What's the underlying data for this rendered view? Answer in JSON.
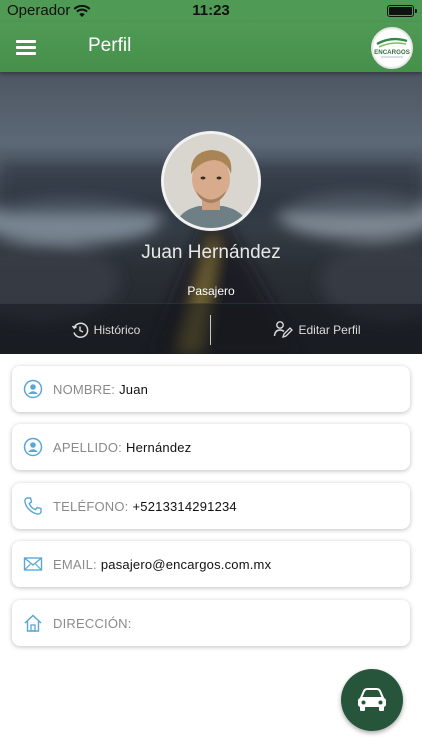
{
  "status_bar": {
    "carrier": "Operador",
    "time": "11:23"
  },
  "nav": {
    "title": "Perfil",
    "logo_text": "ENCARGOS"
  },
  "profile": {
    "name": "Juan Hernández",
    "role": "Pasajero"
  },
  "actions": {
    "history_label": "Histórico",
    "edit_label": "Editar Perfil"
  },
  "fields": {
    "nombre": {
      "label": "NOMBRE:",
      "value": "Juan",
      "icon": "user-badge-icon"
    },
    "apellido": {
      "label": "APELLIDO:",
      "value": "Hernández",
      "icon": "user-badge-icon"
    },
    "telefono": {
      "label": "TELÉFONO:",
      "value": "+5213314291234",
      "icon": "phone-icon"
    },
    "email": {
      "label": "EMAIL:",
      "value": "pasajero@encargos.com.mx",
      "icon": "envelope-icon"
    },
    "direccion": {
      "label": "DIRECCIÓN:",
      "value": "",
      "icon": "home-icon"
    }
  },
  "fab": {
    "icon": "car-icon"
  },
  "colors": {
    "primary_green": "#4f9a55",
    "fab_green": "#27553b",
    "icon_blue": "#5aa7d6"
  }
}
